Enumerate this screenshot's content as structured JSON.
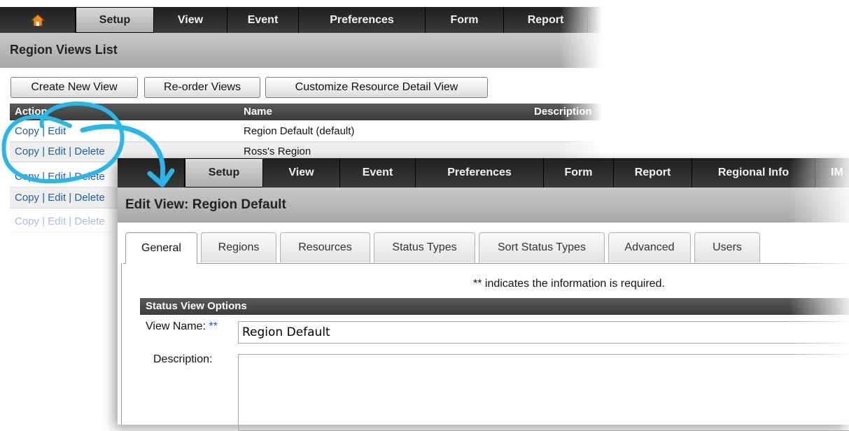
{
  "back_window": {
    "nav": [
      "Setup",
      "View",
      "Event",
      "Preferences",
      "Form",
      "Report"
    ],
    "title": "Region Views List",
    "buttons": [
      "Create New View",
      "Re-order Views",
      "Customize Resource Detail View"
    ],
    "columns": [
      "Action",
      "Name",
      "Description"
    ],
    "rows": [
      {
        "copy": "Copy",
        "sep1": " | ",
        "edit": "Edit",
        "sep2": "",
        "delete": "",
        "name": "Region Default (default)"
      },
      {
        "copy": "Copy",
        "sep1": " | ",
        "edit": "Edit",
        "sep2": " | ",
        "delete": "Delete",
        "name": "Ross's Region"
      },
      {
        "copy": "Copy",
        "sep1": " | ",
        "edit": "Edit",
        "sep2": " | ",
        "delete": "Delete",
        "name": ""
      },
      {
        "copy": "Copy",
        "sep1": " | ",
        "edit": "Edit",
        "sep2": " | ",
        "delete": "Delete",
        "name": ""
      },
      {
        "copy": "Copy",
        "sep1": " | ",
        "edit": "Edit",
        "sep2": " | ",
        "delete": "Delete",
        "name": ""
      }
    ]
  },
  "front_window": {
    "nav": [
      "Setup",
      "View",
      "Event",
      "Preferences",
      "Form",
      "Report",
      "Regional Info",
      "IM"
    ],
    "title": "Edit View: Region Default",
    "tabs": [
      "General",
      "Regions",
      "Resources",
      "Status Types",
      "Sort Status Types",
      "Advanced",
      "Users"
    ],
    "required_note": "** indicates the information is required.",
    "section_title": "Status View Options",
    "view_name_label": "View Name:",
    "required_marker": "**",
    "view_name_value": "Region Default",
    "description_label": "Description:"
  },
  "colors": {
    "accent_link": "#1f5fa8",
    "annotation_arrow": "#29b6e8",
    "nav_bg": "#2a2a2a"
  },
  "icons": {
    "home": "house-icon"
  }
}
